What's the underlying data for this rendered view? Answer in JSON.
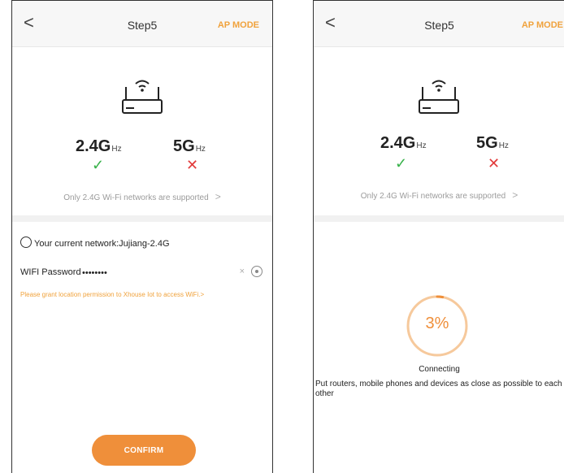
{
  "screens": [
    {
      "header": {
        "back_label": "<",
        "title": "Step5",
        "mode_label": "AP MODE"
      },
      "bands": {
        "band24_main": "2.4G",
        "band24_unit": "Hz",
        "band5_main": "5G",
        "band5_unit": "Hz",
        "supported_mark": "✓",
        "unsupported_mark": "✕"
      },
      "support_note": "Only 2.4G Wi-Fi networks are supported",
      "support_chevron": ">",
      "network": {
        "current_label": "Your current network:Jujiang-2.4G"
      },
      "password": {
        "label": "WIFI Password",
        "value": "••••••••",
        "clear": "×"
      },
      "permission_note": "Please grant location permission to Xhouse Iot to access WiFi.>",
      "confirm_label": "CONFIRM"
    },
    {
      "header": {
        "back_label": "<",
        "title": "Step5",
        "mode_label": "AP MODE"
      },
      "bands": {
        "band24_main": "2.4G",
        "band24_unit": "Hz",
        "band5_main": "5G",
        "band5_unit": "Hz",
        "supported_mark": "✓",
        "unsupported_mark": "✕"
      },
      "support_note": "Only 2.4G Wi-Fi networks are supported",
      "support_chevron": ">",
      "progress": {
        "percent_label": "3%",
        "percent_value": 3,
        "status": "Connecting"
      },
      "hint": "Put routers, mobile phones and devices as close as possible to each other"
    }
  ],
  "colors": {
    "accent": "#ef8f3a",
    "ok": "#38b24a",
    "error": "#e23b3b"
  },
  "icons": {
    "router": "router-icon",
    "wifi": "wifi-icon",
    "eye": "eye-icon"
  }
}
